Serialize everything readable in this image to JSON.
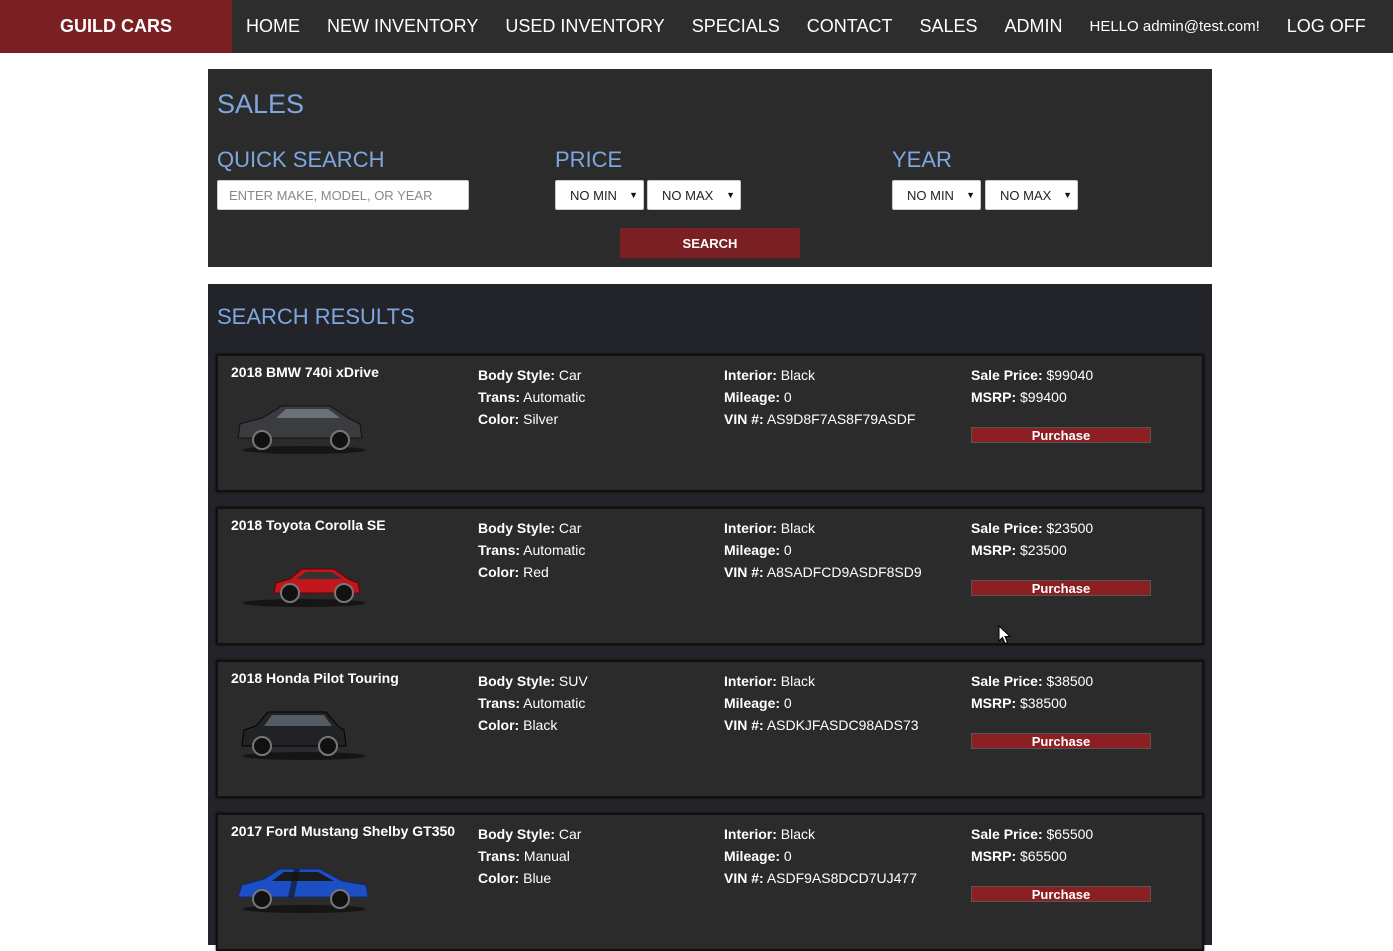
{
  "nav": {
    "brand": "GUILD CARS",
    "items": [
      "HOME",
      "NEW INVENTORY",
      "USED INVENTORY",
      "SPECIALS",
      "CONTACT",
      "SALES",
      "ADMIN"
    ],
    "hello": "HELLO admin@test.com!",
    "logoff": "LOG OFF"
  },
  "sales": {
    "title": "SALES",
    "quick_search_label": "QUICK SEARCH",
    "quick_search_placeholder": "ENTER MAKE, MODEL, OR YEAR",
    "price_label": "PRICE",
    "year_label": "YEAR",
    "price_min": "NO MIN",
    "price_max": "NO MAX",
    "year_min": "NO MIN",
    "year_max": "NO MAX",
    "search_button": "SEARCH"
  },
  "results": {
    "title": "SEARCH RESULTS",
    "labels": {
      "body_style": "Body Style:",
      "trans": "Trans:",
      "color": "Color:",
      "interior": "Interior:",
      "mileage": "Mileage:",
      "vin": "VIN #:",
      "sale_price": "Sale Price:",
      "msrp": "MSRP:",
      "purchase": "Purchase"
    },
    "cars": [
      {
        "title": "2018 BMW 740i xDrive",
        "body_style": "Car",
        "trans": "Automatic",
        "color": "Silver",
        "interior": "Black",
        "mileage": "0",
        "vin": "AS9D8F7AS8F79ASDF",
        "sale_price": "$99040",
        "msrp": "$99400",
        "paint": "#3a3c40"
      },
      {
        "title": "2018 Toyota Corolla SE",
        "body_style": "Car",
        "trans": "Automatic",
        "color": "Red",
        "interior": "Black",
        "mileage": "0",
        "vin": "A8SADFCD9ASDF8SD9",
        "sale_price": "$23500",
        "msrp": "$23500",
        "paint": "#c0161c"
      },
      {
        "title": "2018 Honda Pilot Touring",
        "body_style": "SUV",
        "trans": "Automatic",
        "color": "Black",
        "interior": "Black",
        "mileage": "0",
        "vin": "ASDKJFASDC98ADS73",
        "sale_price": "$38500",
        "msrp": "$38500",
        "paint": "#222326"
      },
      {
        "title": "2017 Ford Mustang Shelby GT350",
        "body_style": "Car",
        "trans": "Manual",
        "color": "Blue",
        "interior": "Black",
        "mileage": "0",
        "vin": "ASDF9AS8DCD7UJ477",
        "sale_price": "$65500",
        "msrp": "$65500",
        "paint": "#1d4fc4"
      }
    ]
  },
  "colors": {
    "brand_red": "#7a2022",
    "heading_blue": "#7ea6e0",
    "panel_dark": "#2b2b2b"
  }
}
